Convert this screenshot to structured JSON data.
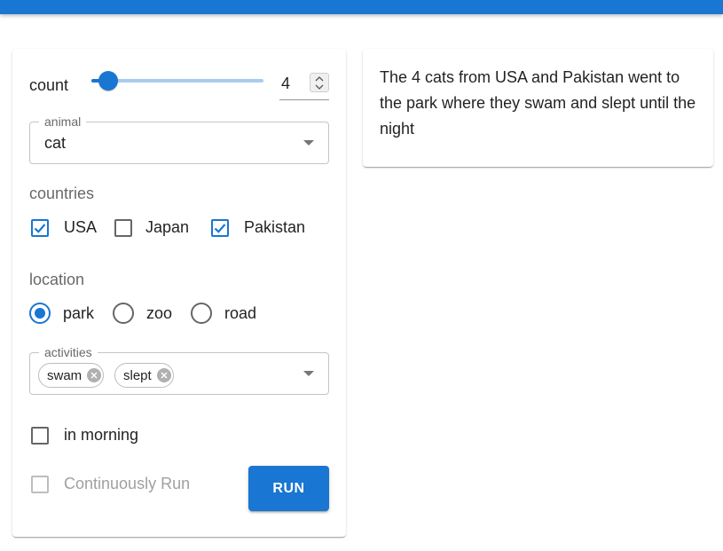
{
  "controls": {
    "count": {
      "label": "count",
      "value": "4",
      "slider_fraction": 0.1
    },
    "animal": {
      "label": "animal",
      "value": "cat"
    },
    "countries": {
      "label": "countries",
      "options": [
        {
          "label": "USA",
          "checked": true
        },
        {
          "label": "Japan",
          "checked": false
        },
        {
          "label": "Pakistan",
          "checked": true
        }
      ]
    },
    "location": {
      "label": "location",
      "options": [
        {
          "label": "park",
          "selected": true
        },
        {
          "label": "zoo",
          "selected": false
        },
        {
          "label": "road",
          "selected": false
        }
      ]
    },
    "activities": {
      "label": "activities",
      "chips": [
        "swam",
        "slept"
      ]
    },
    "in_morning": {
      "label": "in morning",
      "checked": false
    },
    "continuously_run": {
      "label": "Continuously Run",
      "checked": false,
      "disabled": true
    },
    "run_label": "RUN"
  },
  "output": {
    "text": "The 4 cats from USA and Pakistan went to the park where they swam and slept until the night"
  },
  "colors": {
    "primary": "#1976d2"
  },
  "icons": [
    "check-icon",
    "chevron-down-icon",
    "cancel-circle-icon",
    "spin-up-icon",
    "spin-down-icon"
  ]
}
